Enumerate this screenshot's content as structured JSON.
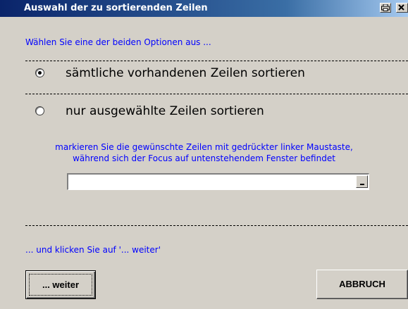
{
  "window": {
    "title": "Auswahl der zu sortierenden Zeilen",
    "titlebar_colors": [
      "#0a246a",
      "#a6caf0"
    ]
  },
  "titlebar_buttons": {
    "print_icon": "print-icon",
    "close_icon": "close-icon"
  },
  "instruction": "Wählen Sie eine der beiden Optionen aus ...",
  "options": {
    "all_rows": {
      "label": "sämtliche vorhandenen Zeilen sortieren",
      "selected": true
    },
    "selected_rows": {
      "label": "nur ausgewählte Zeilen sortieren",
      "selected": false
    }
  },
  "hint": {
    "line1": "markieren Sie die gewünschte Zeilen mit gedrückter linker Maustaste,",
    "line2": "während sich der Focus auf untenstehendem  Fenster befindet"
  },
  "range_combo": {
    "value": ""
  },
  "footer": "... und klicken Sie auf '... weiter'",
  "buttons": {
    "weiter": "... weiter",
    "abbruch": "ABBRUCH"
  },
  "colors": {
    "text_accent": "#0000ff",
    "background": "#d4d0c8"
  }
}
